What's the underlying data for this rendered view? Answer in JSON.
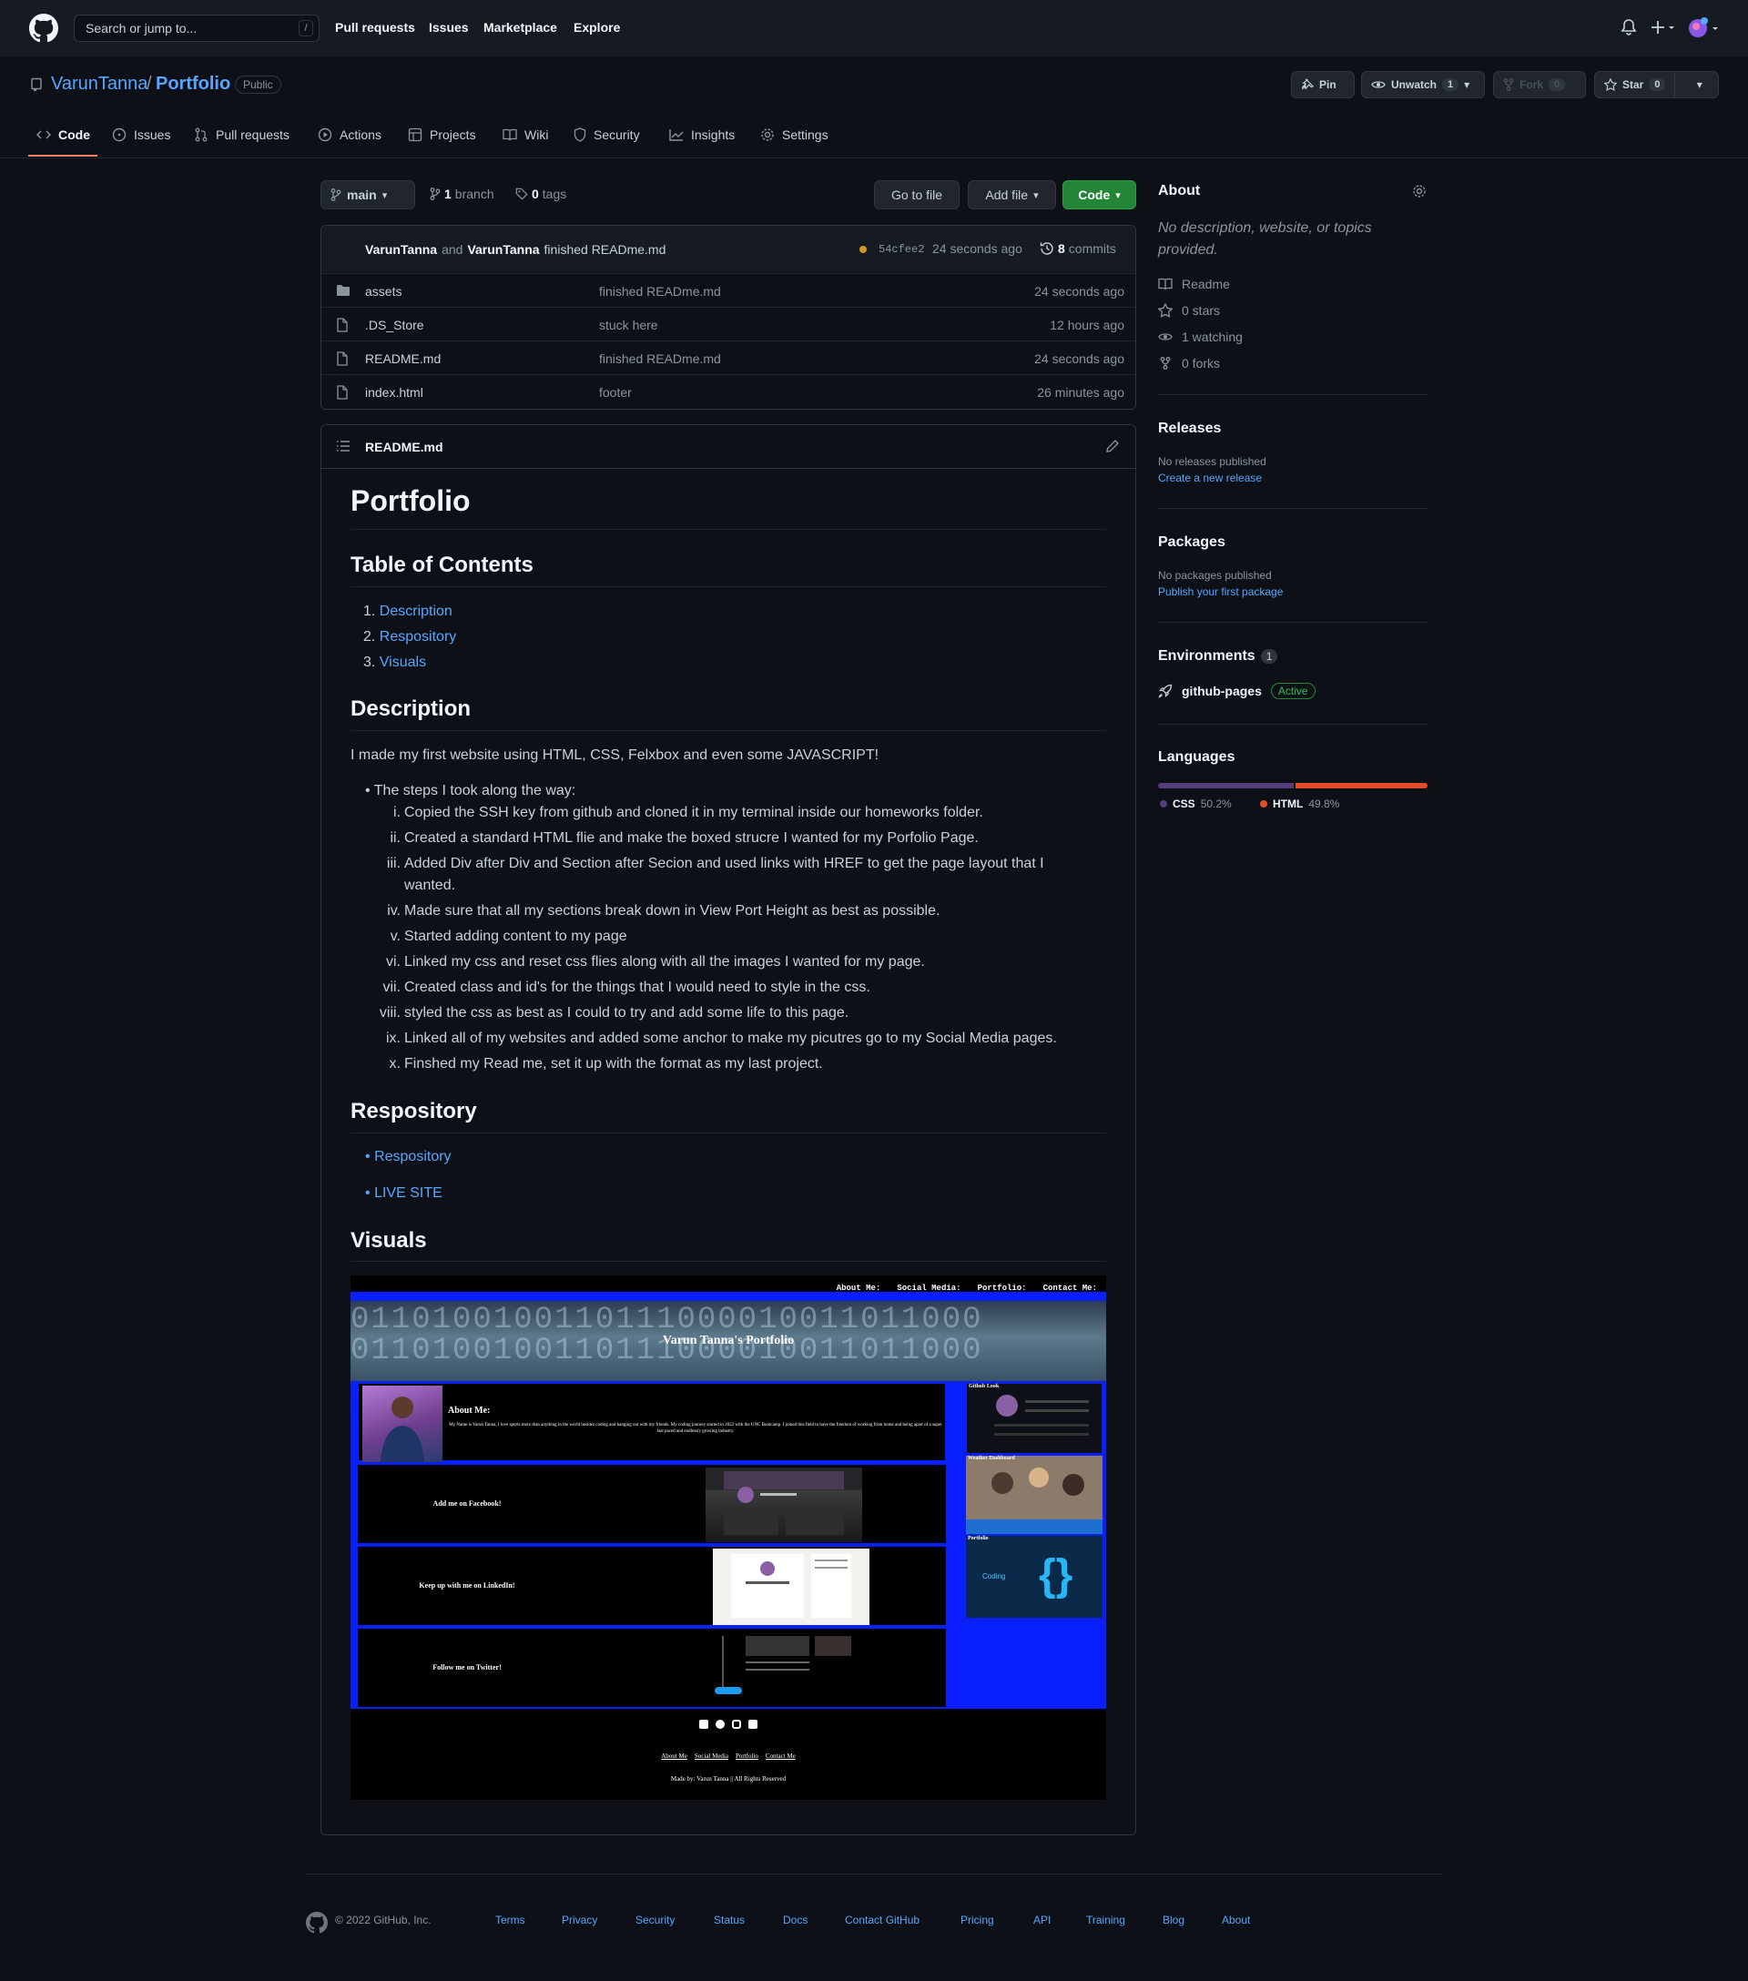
{
  "header": {
    "search_placeholder": "Search or jump to...",
    "slash_key": "/",
    "nav": [
      "Pull requests",
      "Issues",
      "Marketplace",
      "Explore"
    ]
  },
  "repo": {
    "owner": "VarunTanna",
    "separator": "/",
    "name": "Portfolio",
    "visibility": "Public",
    "pin_label": "Pin",
    "unwatch_label": "Unwatch",
    "watch_count": "1",
    "fork_label": "Fork",
    "fork_count": "0",
    "star_label": "Star",
    "star_count": "0"
  },
  "tabs": [
    "Code",
    "Issues",
    "Pull requests",
    "Actions",
    "Projects",
    "Wiki",
    "Security",
    "Insights",
    "Settings"
  ],
  "branchbar": {
    "branch": "main",
    "branch_count": "1",
    "branch_word": "branch",
    "tag_count": "0",
    "tag_word": "tags",
    "go_to_file": "Go to file",
    "add_file": "Add file",
    "code": "Code"
  },
  "commit": {
    "author1": "VarunTanna",
    "and_word": "and",
    "author2": "VarunTanna",
    "message": "finished READme.md",
    "sha": "54cfee2",
    "age": "24 seconds ago",
    "commit_count": "8",
    "commit_word": "commits"
  },
  "files": [
    {
      "name": "assets",
      "message": "finished READme.md",
      "age": "24 seconds ago",
      "type": "folder"
    },
    {
      "name": ".DS_Store",
      "message": "stuck here",
      "age": "12 hours ago",
      "type": "file"
    },
    {
      "name": "README.md",
      "message": "finished READme.md",
      "age": "24 seconds ago",
      "type": "file"
    },
    {
      "name": "index.html",
      "message": "footer",
      "age": "26 minutes ago",
      "type": "file"
    }
  ],
  "readme": {
    "filename": "README.md",
    "title": "Portfolio",
    "toc_heading": "Table of Contents",
    "toc": [
      "Description",
      "Respository",
      "Visuals"
    ],
    "desc_heading": "Description",
    "desc_text": "I made my first website using HTML, CSS, Felxbox and even some JAVASCRIPT!",
    "steps_intro": "The steps I took along the way:",
    "steps": [
      {
        "num": "i.",
        "text": "Copied the SSH key from github and cloned it in my terminal inside our homeworks folder."
      },
      {
        "num": "ii.",
        "text": "Created a standard HTML flie and make the boxed strucre I wanted for my Porfolio Page."
      },
      {
        "num": "iii.",
        "text": "Added Div after Div and Section after Secion and used links with HREF to get the page layout that I"
      },
      {
        "num": "",
        "text": "wanted."
      },
      {
        "num": "iv.",
        "text": "Made sure that all my sections break down in View Port Height as best as possible."
      },
      {
        "num": "v.",
        "text": "Started adding content to my page"
      },
      {
        "num": "vi.",
        "text": "Linked my css and reset css flies along with all the images I wanted for my page."
      },
      {
        "num": "vii.",
        "text": "Created class and id's for the things that I would need to style in the css."
      },
      {
        "num": "viii.",
        "text": "styled the css as best as I could to try and add some life to this page."
      },
      {
        "num": "ix.",
        "text": "Linked all of my websites and added some anchor to make my picutres go to my Social Media pages."
      },
      {
        "num": "x.",
        "text": "Finshed my Read me, set it up with the format as my last project."
      }
    ],
    "repo_heading": "Respository",
    "repo_links": [
      "Respository",
      "LIVE SITE"
    ],
    "visuals_heading": "Visuals"
  },
  "preview": {
    "nav": [
      "About Me:",
      "Social Media:",
      "Portfolio:",
      "Contact Me:"
    ],
    "banner_title": "Varun Tanna's Portfolio",
    "binary_line": "0110100100110111000010011011000",
    "about_heading": "About Me:",
    "about_text": "My Name is Varun Tanna, I love sports more than anything in the world besides coding and hanging out with my friends. My coding journey started in 2022 with the UNC Bootcamp. I joined this field to have the freedom of working from home and being apart of a super fast paced and endlessly growing industry.",
    "facebook": "Add me on Facebook!",
    "linkedin": "Keep up with me on LinkedIn!",
    "twitter": "Follow me on Twitter!",
    "github_look": "Github Look",
    "weather": "Weather Dashboard",
    "portfolio": "Portfolio",
    "coding": "Coding",
    "footer_links": [
      "About Me",
      "Social Media",
      "Portfolio",
      "Contact Me"
    ],
    "footer_credit": "Made by: Varun Tanna || All Rights Reserved"
  },
  "about": {
    "heading": "About",
    "description": "No description, website, or topics provided.",
    "items": [
      "Readme",
      "0 stars",
      "1 watching",
      "0 forks"
    ]
  },
  "releases": {
    "heading": "Releases",
    "none": "No releases published",
    "link": "Create a new release"
  },
  "packages": {
    "heading": "Packages",
    "none": "No packages published",
    "link": "Publish your first package"
  },
  "environments": {
    "heading": "Environments",
    "count": "1",
    "name": "github-pages",
    "status": "Active"
  },
  "languages": {
    "heading": "Languages",
    "items": [
      {
        "name": "CSS",
        "percent": "50.2%",
        "value": 50.2,
        "color": "#563d7c"
      },
      {
        "name": "HTML",
        "percent": "49.8%",
        "value": 49.8,
        "color": "#e34c26"
      }
    ]
  },
  "footer": {
    "copyright": "© 2022 GitHub, Inc.",
    "links": [
      "Terms",
      "Privacy",
      "Security",
      "Status",
      "Docs",
      "Contact GitHub",
      "Pricing",
      "API",
      "Training",
      "Blog",
      "About"
    ]
  },
  "colors": {
    "accent": "#58a6ff",
    "primary_button": "#238636",
    "tab_underline": "#f78166",
    "active_green": "#3fb950"
  }
}
